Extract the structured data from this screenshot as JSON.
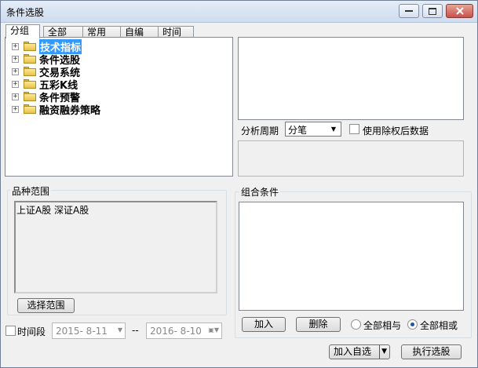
{
  "window": {
    "title": "条件选股"
  },
  "tabs": [
    "分组",
    "全部",
    "常用",
    "自编",
    "时间"
  ],
  "tree": {
    "expander_symbol": "+",
    "items": [
      "技术指标",
      "条件选股",
      "交易系统",
      "五彩K线",
      "条件预警",
      "融资融券策略"
    ]
  },
  "analysis": {
    "period_label": "分析周期",
    "period_value": "分笔",
    "adjust_label": "使用除权后数据"
  },
  "variety": {
    "title": "品种范围",
    "content": "上证A股  深证A股",
    "select_range_button": "选择范围"
  },
  "combo": {
    "title": "组合条件",
    "add_button": "加入",
    "delete_button": "删除",
    "and_label": "全部相与",
    "or_label": "全部相或"
  },
  "time_range": {
    "label": "时间段",
    "start": "2015- 8-11",
    "separator": "--",
    "end": "2016- 8-10"
  },
  "footer": {
    "add_custom_button": "加入自选",
    "execute_button": "执行选股"
  }
}
